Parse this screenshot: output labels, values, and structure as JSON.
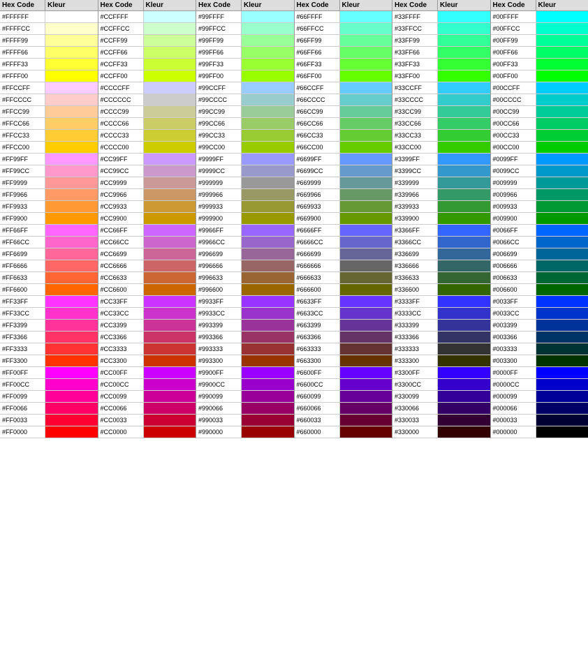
{
  "columns": [
    {
      "header": {
        "hex": "Hex Code",
        "kleur": "Kleur"
      },
      "rows": [
        {
          "hex": "#FFFFFF",
          "color": "#FFFFFF"
        },
        {
          "hex": "#FFFFCC",
          "color": "#FFFFCC"
        },
        {
          "hex": "#FFFF99",
          "color": "#FFFF99"
        },
        {
          "hex": "#FFFF66",
          "color": "#FFFF66"
        },
        {
          "hex": "#FFFF33",
          "color": "#FFFF33"
        },
        {
          "hex": "#FFFF00",
          "color": "#FFFF00"
        },
        {
          "hex": "#FFCCFF",
          "color": "#FFCCFF"
        },
        {
          "hex": "#FFCCCC",
          "color": "#FFCCCC"
        },
        {
          "hex": "#FFCC99",
          "color": "#FFCC99"
        },
        {
          "hex": "#FFCC66",
          "color": "#FFCC66"
        },
        {
          "hex": "#FFCC33",
          "color": "#FFCC33"
        },
        {
          "hex": "#FFCC00",
          "color": "#FFCC00"
        },
        {
          "hex": "#FF99FF",
          "color": "#FF99FF"
        },
        {
          "hex": "#FF99CC",
          "color": "#FF99CC"
        },
        {
          "hex": "#FF9999",
          "color": "#FF9999"
        },
        {
          "hex": "#FF9966",
          "color": "#FF9966"
        },
        {
          "hex": "#FF9933",
          "color": "#FF9933"
        },
        {
          "hex": "#FF9900",
          "color": "#FF9900"
        },
        {
          "hex": "#FF66FF",
          "color": "#FF66FF"
        },
        {
          "hex": "#FF66CC",
          "color": "#FF66CC"
        },
        {
          "hex": "#FF6699",
          "color": "#FF6699"
        },
        {
          "hex": "#FF6666",
          "color": "#FF6666"
        },
        {
          "hex": "#FF6633",
          "color": "#FF6633"
        },
        {
          "hex": "#FF6600",
          "color": "#FF6600"
        },
        {
          "hex": "#FF33FF",
          "color": "#FF33FF"
        },
        {
          "hex": "#FF33CC",
          "color": "#FF33CC"
        },
        {
          "hex": "#FF3399",
          "color": "#FF3399"
        },
        {
          "hex": "#FF3366",
          "color": "#FF3366"
        },
        {
          "hex": "#FF3333",
          "color": "#FF3333"
        },
        {
          "hex": "#FF3300",
          "color": "#FF3300"
        },
        {
          "hex": "#FF00FF",
          "color": "#FF00FF"
        },
        {
          "hex": "#FF00CC",
          "color": "#FF00CC"
        },
        {
          "hex": "#FF0099",
          "color": "#FF0099"
        },
        {
          "hex": "#FF0066",
          "color": "#FF0066"
        },
        {
          "hex": "#FF0033",
          "color": "#FF0033"
        },
        {
          "hex": "#FF0000",
          "color": "#FF0000"
        }
      ]
    },
    {
      "header": {
        "hex": "Hex Code",
        "kleur": "Kleur"
      },
      "rows": [
        {
          "hex": "#CCFFFF",
          "color": "#CCFFFF"
        },
        {
          "hex": "#CCFFCC",
          "color": "#CCFFCC"
        },
        {
          "hex": "#CCFF99",
          "color": "#CCFF99"
        },
        {
          "hex": "#CCFF66",
          "color": "#CCFF66"
        },
        {
          "hex": "#CCFF33",
          "color": "#CCFF33"
        },
        {
          "hex": "#CCFF00",
          "color": "#CCFF00"
        },
        {
          "hex": "#CCCCFF",
          "color": "#CCCCFF"
        },
        {
          "hex": "#CCCCCC",
          "color": "#CCCCCC"
        },
        {
          "hex": "#CCCC99",
          "color": "#CCCC99"
        },
        {
          "hex": "#CCCC66",
          "color": "#CCCC66"
        },
        {
          "hex": "#CCCC33",
          "color": "#CCCC33"
        },
        {
          "hex": "#CCCC00",
          "color": "#CCCC00"
        },
        {
          "hex": "#CC99FF",
          "color": "#CC99FF"
        },
        {
          "hex": "#CC99CC",
          "color": "#CC99CC"
        },
        {
          "hex": "#CC9999",
          "color": "#CC9999"
        },
        {
          "hex": "#CC9966",
          "color": "#CC9966"
        },
        {
          "hex": "#CC9933",
          "color": "#CC9933"
        },
        {
          "hex": "#CC9900",
          "color": "#CC9900"
        },
        {
          "hex": "#CC66FF",
          "color": "#CC66FF"
        },
        {
          "hex": "#CC66CC",
          "color": "#CC66CC"
        },
        {
          "hex": "#CC6699",
          "color": "#CC6699"
        },
        {
          "hex": "#CC6666",
          "color": "#CC6666"
        },
        {
          "hex": "#CC6633",
          "color": "#CC6633"
        },
        {
          "hex": "#CC6600",
          "color": "#CC6600"
        },
        {
          "hex": "#CC33FF",
          "color": "#CC33FF"
        },
        {
          "hex": "#CC33CC",
          "color": "#CC33CC"
        },
        {
          "hex": "#CC3399",
          "color": "#CC3399"
        },
        {
          "hex": "#CC3366",
          "color": "#CC3366"
        },
        {
          "hex": "#CC3333",
          "color": "#CC3333"
        },
        {
          "hex": "#CC3300",
          "color": "#CC3300"
        },
        {
          "hex": "#CC00FF",
          "color": "#CC00FF"
        },
        {
          "hex": "#CC00CC",
          "color": "#CC00CC"
        },
        {
          "hex": "#CC0099",
          "color": "#CC0099"
        },
        {
          "hex": "#CC0066",
          "color": "#CC0066"
        },
        {
          "hex": "#CC0033",
          "color": "#CC0033"
        },
        {
          "hex": "#CC0000",
          "color": "#CC0000"
        }
      ]
    },
    {
      "header": {
        "hex": "Hex Code",
        "kleur": "Kleur"
      },
      "rows": [
        {
          "hex": "#99FFFF",
          "color": "#99FFFF"
        },
        {
          "hex": "#99FFCC",
          "color": "#99FFCC"
        },
        {
          "hex": "#99FF99",
          "color": "#99FF99"
        },
        {
          "hex": "#99FF66",
          "color": "#99FF66"
        },
        {
          "hex": "#99FF33",
          "color": "#99FF33"
        },
        {
          "hex": "#99FF00",
          "color": "#99FF00"
        },
        {
          "hex": "#99CCFF",
          "color": "#99CCFF"
        },
        {
          "hex": "#99CCCC",
          "color": "#99CCCC"
        },
        {
          "hex": "#99CC99",
          "color": "#99CC99"
        },
        {
          "hex": "#99CC66",
          "color": "#99CC66"
        },
        {
          "hex": "#99CC33",
          "color": "#99CC33"
        },
        {
          "hex": "#99CC00",
          "color": "#99CC00"
        },
        {
          "hex": "#9999FF",
          "color": "#9999FF"
        },
        {
          "hex": "#9999CC",
          "color": "#9999CC"
        },
        {
          "hex": "#999999",
          "color": "#999999"
        },
        {
          "hex": "#999966",
          "color": "#999966"
        },
        {
          "hex": "#999933",
          "color": "#999933"
        },
        {
          "hex": "#999900",
          "color": "#999900"
        },
        {
          "hex": "#9966FF",
          "color": "#9966FF"
        },
        {
          "hex": "#9966CC",
          "color": "#9966CC"
        },
        {
          "hex": "#996699",
          "color": "#996699"
        },
        {
          "hex": "#996666",
          "color": "#996666"
        },
        {
          "hex": "#996633",
          "color": "#996633"
        },
        {
          "hex": "#996600",
          "color": "#996600"
        },
        {
          "hex": "#9933FF",
          "color": "#9933FF"
        },
        {
          "hex": "#9933CC",
          "color": "#9933CC"
        },
        {
          "hex": "#993399",
          "color": "#993399"
        },
        {
          "hex": "#993366",
          "color": "#993366"
        },
        {
          "hex": "#993333",
          "color": "#993333"
        },
        {
          "hex": "#993300",
          "color": "#993300"
        },
        {
          "hex": "#9900FF",
          "color": "#9900FF"
        },
        {
          "hex": "#9900CC",
          "color": "#9900CC"
        },
        {
          "hex": "#990099",
          "color": "#990099"
        },
        {
          "hex": "#990066",
          "color": "#990066"
        },
        {
          "hex": "#990033",
          "color": "#990033"
        },
        {
          "hex": "#990000",
          "color": "#990000"
        }
      ]
    },
    {
      "header": {
        "hex": "Hex Code",
        "kleur": "Kleur"
      },
      "rows": [
        {
          "hex": "#66FFFF",
          "color": "#66FFFF"
        },
        {
          "hex": "#66FFCC",
          "color": "#66FFCC"
        },
        {
          "hex": "#66FF99",
          "color": "#66FF99"
        },
        {
          "hex": "#66FF66",
          "color": "#66FF66"
        },
        {
          "hex": "#66FF33",
          "color": "#66FF33"
        },
        {
          "hex": "#66FF00",
          "color": "#66FF00"
        },
        {
          "hex": "#66CCFF",
          "color": "#66CCFF"
        },
        {
          "hex": "#66CCCC",
          "color": "#66CCCC"
        },
        {
          "hex": "#66CC99",
          "color": "#66CC99"
        },
        {
          "hex": "#66CC66",
          "color": "#66CC66"
        },
        {
          "hex": "#66CC33",
          "color": "#66CC33"
        },
        {
          "hex": "#66CC00",
          "color": "#66CC00"
        },
        {
          "hex": "#6699FF",
          "color": "#6699FF"
        },
        {
          "hex": "#6699CC",
          "color": "#6699CC"
        },
        {
          "hex": "#669999",
          "color": "#669999"
        },
        {
          "hex": "#669966",
          "color": "#669966"
        },
        {
          "hex": "#669933",
          "color": "#669933"
        },
        {
          "hex": "#669900",
          "color": "#669900"
        },
        {
          "hex": "#6666FF",
          "color": "#6666FF"
        },
        {
          "hex": "#6666CC",
          "color": "#6666CC"
        },
        {
          "hex": "#666699",
          "color": "#666699"
        },
        {
          "hex": "#666666",
          "color": "#666666"
        },
        {
          "hex": "#666633",
          "color": "#666633"
        },
        {
          "hex": "#666600",
          "color": "#666600"
        },
        {
          "hex": "#6633FF",
          "color": "#6633FF"
        },
        {
          "hex": "#6633CC",
          "color": "#6633CC"
        },
        {
          "hex": "#663399",
          "color": "#663399"
        },
        {
          "hex": "#663366",
          "color": "#663366"
        },
        {
          "hex": "#663333",
          "color": "#663333"
        },
        {
          "hex": "#663300",
          "color": "#663300"
        },
        {
          "hex": "#6600FF",
          "color": "#6600FF"
        },
        {
          "hex": "#6600CC",
          "color": "#6600CC"
        },
        {
          "hex": "#660099",
          "color": "#660099"
        },
        {
          "hex": "#660066",
          "color": "#660066"
        },
        {
          "hex": "#660033",
          "color": "#660033"
        },
        {
          "hex": "#660000",
          "color": "#660000"
        }
      ]
    },
    {
      "header": {
        "hex": "Hex Code",
        "kleur": "Kleur"
      },
      "rows": [
        {
          "hex": "#33FFFF",
          "color": "#33FFFF"
        },
        {
          "hex": "#33FFCC",
          "color": "#33FFCC"
        },
        {
          "hex": "#33FF99",
          "color": "#33FF99"
        },
        {
          "hex": "#33FF66",
          "color": "#33FF66"
        },
        {
          "hex": "#33FF33",
          "color": "#33FF33"
        },
        {
          "hex": "#33FF00",
          "color": "#33FF00"
        },
        {
          "hex": "#33CCFF",
          "color": "#33CCFF"
        },
        {
          "hex": "#33CCCC",
          "color": "#33CCCC"
        },
        {
          "hex": "#33CC99",
          "color": "#33CC99"
        },
        {
          "hex": "#33CC66",
          "color": "#33CC66"
        },
        {
          "hex": "#33CC33",
          "color": "#33CC33"
        },
        {
          "hex": "#33CC00",
          "color": "#33CC00"
        },
        {
          "hex": "#3399FF",
          "color": "#3399FF"
        },
        {
          "hex": "#3399CC",
          "color": "#3399CC"
        },
        {
          "hex": "#339999",
          "color": "#339999"
        },
        {
          "hex": "#339966",
          "color": "#339966"
        },
        {
          "hex": "#339933",
          "color": "#339933"
        },
        {
          "hex": "#339900",
          "color": "#339900"
        },
        {
          "hex": "#3366FF",
          "color": "#3366FF"
        },
        {
          "hex": "#3366CC",
          "color": "#3366CC"
        },
        {
          "hex": "#336699",
          "color": "#336699"
        },
        {
          "hex": "#336666",
          "color": "#336666"
        },
        {
          "hex": "#336633",
          "color": "#336633"
        },
        {
          "hex": "#336600",
          "color": "#336600"
        },
        {
          "hex": "#3333FF",
          "color": "#3333FF"
        },
        {
          "hex": "#3333CC",
          "color": "#3333CC"
        },
        {
          "hex": "#333399",
          "color": "#333399"
        },
        {
          "hex": "#333366",
          "color": "#333366"
        },
        {
          "hex": "#333333",
          "color": "#333333"
        },
        {
          "hex": "#333300",
          "color": "#333300"
        },
        {
          "hex": "#3300FF",
          "color": "#3300FF"
        },
        {
          "hex": "#3300CC",
          "color": "#3300CC"
        },
        {
          "hex": "#330099",
          "color": "#330099"
        },
        {
          "hex": "#330066",
          "color": "#330066"
        },
        {
          "hex": "#330033",
          "color": "#330033"
        },
        {
          "hex": "#330000",
          "color": "#330000"
        }
      ]
    },
    {
      "header": {
        "hex": "Hex Code",
        "kleur": "Kleur"
      },
      "rows": [
        {
          "hex": "#00FFFF",
          "color": "#00FFFF"
        },
        {
          "hex": "#00FFCC",
          "color": "#00FFCC"
        },
        {
          "hex": "#00FF99",
          "color": "#00FF99"
        },
        {
          "hex": "#00FF66",
          "color": "#00FF66"
        },
        {
          "hex": "#00FF33",
          "color": "#00FF33"
        },
        {
          "hex": "#00FF00",
          "color": "#00FF00"
        },
        {
          "hex": "#00CCFF",
          "color": "#00CCFF"
        },
        {
          "hex": "#00CCCC",
          "color": "#00CCCC"
        },
        {
          "hex": "#00CC99",
          "color": "#00CC99"
        },
        {
          "hex": "#00CC66",
          "color": "#00CC66"
        },
        {
          "hex": "#00CC33",
          "color": "#00CC33"
        },
        {
          "hex": "#00CC00",
          "color": "#00CC00"
        },
        {
          "hex": "#0099FF",
          "color": "#0099FF"
        },
        {
          "hex": "#0099CC",
          "color": "#0099CC"
        },
        {
          "hex": "#009999",
          "color": "#009999"
        },
        {
          "hex": "#009966",
          "color": "#009966"
        },
        {
          "hex": "#009933",
          "color": "#009933"
        },
        {
          "hex": "#009900",
          "color": "#009900"
        },
        {
          "hex": "#0066FF",
          "color": "#0066FF"
        },
        {
          "hex": "#0066CC",
          "color": "#0066CC"
        },
        {
          "hex": "#006699",
          "color": "#006699"
        },
        {
          "hex": "#006666",
          "color": "#006666"
        },
        {
          "hex": "#006633",
          "color": "#006633"
        },
        {
          "hex": "#006600",
          "color": "#006600"
        },
        {
          "hex": "#0033FF",
          "color": "#0033FF"
        },
        {
          "hex": "#0033CC",
          "color": "#0033CC"
        },
        {
          "hex": "#003399",
          "color": "#003399"
        },
        {
          "hex": "#003366",
          "color": "#003366"
        },
        {
          "hex": "#003333",
          "color": "#003333"
        },
        {
          "hex": "#003300",
          "color": "#003300"
        },
        {
          "hex": "#0000FF",
          "color": "#0000FF"
        },
        {
          "hex": "#0000CC",
          "color": "#0000CC"
        },
        {
          "hex": "#000099",
          "color": "#000099"
        },
        {
          "hex": "#000066",
          "color": "#000066"
        },
        {
          "hex": "#000033",
          "color": "#000033"
        },
        {
          "hex": "#000000",
          "color": "#000000"
        }
      ]
    }
  ]
}
